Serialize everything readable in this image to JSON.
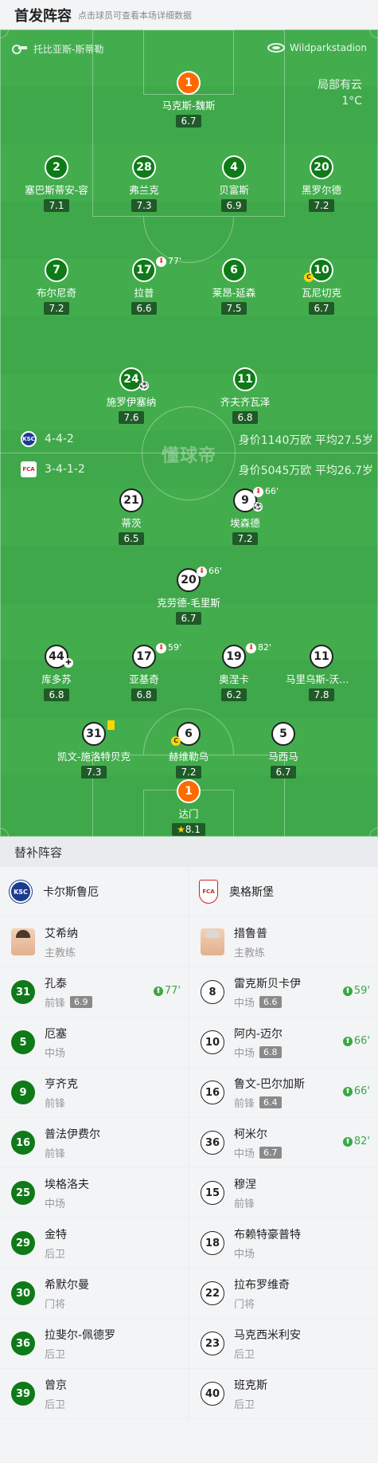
{
  "header": {
    "title": "首发阵容",
    "subtitle": "点击球员可查看本场详细数据"
  },
  "pitch": {
    "referee": "托比亚斯-斯蒂勒",
    "stadium": "Wildparkstadion",
    "weather": "局部有云",
    "temperature": "1°C",
    "watermark": "懂球帝"
  },
  "home": {
    "formation": "4-4-2",
    "summary": "身价1140万欧 平均27.5岁",
    "players": [
      {
        "number": "1",
        "name": "马克斯-魏斯",
        "rating": "6.7"
      },
      {
        "number": "2",
        "name": "塞巴斯蒂安-容",
        "rating": "7.1"
      },
      {
        "number": "28",
        "name": "弗兰克",
        "rating": "7.3"
      },
      {
        "number": "4",
        "name": "贝富斯",
        "rating": "6.9"
      },
      {
        "number": "20",
        "name": "黑罗尔德",
        "rating": "7.2"
      },
      {
        "number": "7",
        "name": "布尔尼奇",
        "rating": "7.2"
      },
      {
        "number": "17",
        "name": "拉普",
        "rating": "6.6",
        "sub_minute": "77'"
      },
      {
        "number": "6",
        "name": "莱昂-延森",
        "rating": "7.5"
      },
      {
        "number": "10",
        "name": "瓦尼切克",
        "rating": "6.7",
        "captain": "C"
      },
      {
        "number": "24",
        "name": "施罗伊塞纳",
        "rating": "7.6"
      },
      {
        "number": "11",
        "name": "齐夫齐瓦泽",
        "rating": "6.8"
      }
    ]
  },
  "away": {
    "formation": "3-4-1-2",
    "summary": "身价5045万欧 平均26.7岁",
    "players": [
      {
        "number": "21",
        "name": "蒂茨",
        "rating": "6.5"
      },
      {
        "number": "9",
        "name": "埃森德",
        "rating": "7.2",
        "sub_minute": "66'"
      },
      {
        "number": "20",
        "name": "克劳德-毛里斯",
        "rating": "6.7",
        "sub_minute": "66'"
      },
      {
        "number": "44",
        "name": "库多苏",
        "rating": "6.8"
      },
      {
        "number": "17",
        "name": "亚基奇",
        "rating": "6.8",
        "sub_minute": "59'"
      },
      {
        "number": "19",
        "name": "奥涅卡",
        "rating": "6.2",
        "sub_minute": "82'"
      },
      {
        "number": "11",
        "name": "马里乌斯-沃尔夫",
        "rating": "7.8"
      },
      {
        "number": "31",
        "name": "凯文-施洛特贝克",
        "rating": "7.3"
      },
      {
        "number": "6",
        "name": "赫维勒乌",
        "rating": "7.2",
        "captain": "C"
      },
      {
        "number": "5",
        "name": "马西马",
        "rating": "6.7"
      },
      {
        "number": "1",
        "name": "达门",
        "rating": "8.1"
      }
    ]
  },
  "substitutes": {
    "title": "替补阵容",
    "home_team": "卡尔斯鲁厄",
    "away_team": "奥格斯堡",
    "home_coach": {
      "name": "艾希纳",
      "role": "主教练"
    },
    "away_coach": {
      "name": "措鲁普",
      "role": "主教练"
    },
    "home": [
      {
        "number": "31",
        "name": "孔泰",
        "position": "前锋",
        "rating": "6.9",
        "on": "77'"
      },
      {
        "number": "5",
        "name": "厄塞",
        "position": "中场"
      },
      {
        "number": "9",
        "name": "亨齐克",
        "position": "前锋"
      },
      {
        "number": "16",
        "name": "普法伊费尔",
        "position": "前锋"
      },
      {
        "number": "25",
        "name": "埃格洛夫",
        "position": "中场"
      },
      {
        "number": "29",
        "name": "金特",
        "position": "后卫"
      },
      {
        "number": "30",
        "name": "希默尔曼",
        "position": "门将"
      },
      {
        "number": "36",
        "name": "拉斐尔-佩德罗",
        "position": "后卫"
      },
      {
        "number": "39",
        "name": "曾京",
        "position": "后卫"
      }
    ],
    "away": [
      {
        "number": "8",
        "name": "雷克斯贝卡伊",
        "position": "中场",
        "rating": "6.6",
        "on": "59'"
      },
      {
        "number": "10",
        "name": "阿内-迈尔",
        "position": "中场",
        "rating": "6.8",
        "on": "66'"
      },
      {
        "number": "16",
        "name": "鲁文-巴尔加斯",
        "position": "前锋",
        "rating": "6.4",
        "on": "66'"
      },
      {
        "number": "36",
        "name": "柯米尔",
        "position": "中场",
        "rating": "6.7",
        "on": "82'"
      },
      {
        "number": "15",
        "name": "穆涅",
        "position": "前锋"
      },
      {
        "number": "18",
        "name": "布赖特豪普特",
        "position": "中场"
      },
      {
        "number": "22",
        "name": "拉布罗维奇",
        "position": "门将"
      },
      {
        "number": "23",
        "name": "马克西米利安",
        "position": "后卫"
      },
      {
        "number": "40",
        "name": "班克斯",
        "position": "后卫"
      }
    ]
  }
}
